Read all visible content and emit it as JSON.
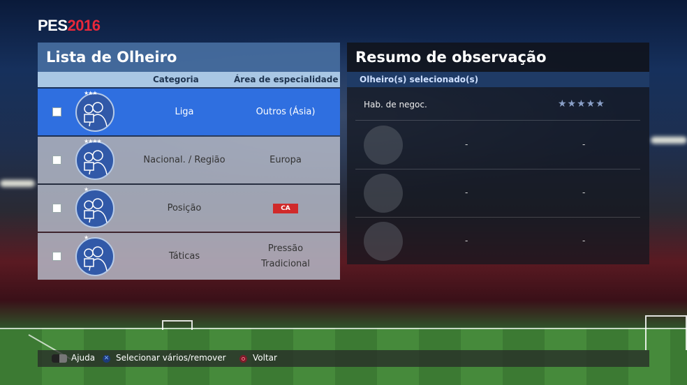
{
  "logo": {
    "part1": "PES",
    "part2": "2016"
  },
  "left_panel": {
    "title": "Lista de Olheiro",
    "columns": {
      "category": "Categoria",
      "area": "Área de especialidade"
    },
    "rows": [
      {
        "category": "Liga",
        "area": "Outros (Ásia)",
        "stars": "★★★",
        "selected": true
      },
      {
        "category": "Nacional. / Região",
        "area": "Europa",
        "stars": "★★★★",
        "selected": false
      },
      {
        "category": "Posição",
        "area_badge": "CA",
        "stars": "★",
        "selected": false
      },
      {
        "category": "Táticas",
        "area_line1": "Pressão",
        "area_line2": "Tradicional",
        "stars": "★",
        "selected": false
      }
    ]
  },
  "right_panel": {
    "title": "Resumo de observação",
    "subheader": "Olheiro(s) selecionado(s)",
    "negotiation_label": "Hab. de negoc.",
    "negotiation_stars": "★★★★★",
    "slots": [
      {
        "col1": "-",
        "col2": "-"
      },
      {
        "col1": "-",
        "col2": "-"
      },
      {
        "col1": "-",
        "col2": "-"
      }
    ]
  },
  "footer": {
    "help": "Ajuda",
    "select": "Selecionar vários/remover",
    "back": "Voltar"
  },
  "colors": {
    "accent_red": "#e8283b",
    "selected_row": "#2f6fe0",
    "header_blue": "#466ea0"
  }
}
